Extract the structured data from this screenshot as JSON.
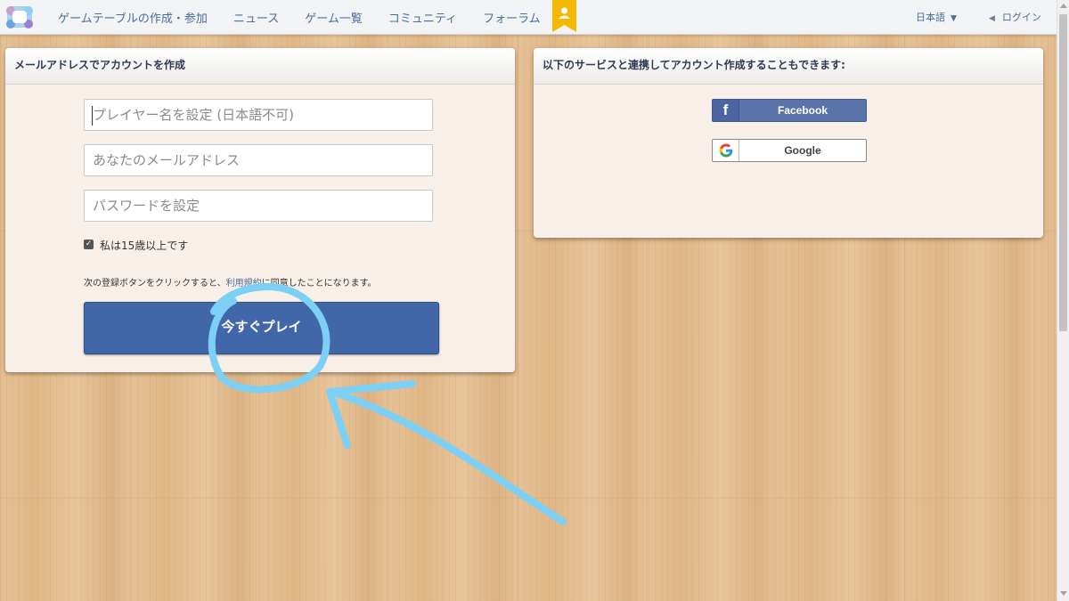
{
  "nav": {
    "items": [
      "ゲームテーブルの作成・参加",
      "ニュース",
      "ゲーム一覧",
      "コミュニティ",
      "フォーラム"
    ],
    "language": "日本語",
    "login": "ログイン"
  },
  "left_panel": {
    "title": "メールアドレスでアカウントを作成",
    "player_name_placeholder": "プレイヤー名を設定 (日本語不可)",
    "email_placeholder": "あなたのメールアドレス",
    "password_placeholder": "パスワードを設定",
    "age_check_label": "私は15歳以上です",
    "terms_prefix": "次の登録ボタンをクリックすると、",
    "terms_link": "利用規約",
    "terms_suffix": "に同意したことになります。",
    "play_button": "今すぐプレイ"
  },
  "right_panel": {
    "title": "以下のサービスと連携してアカウント作成することもできます:",
    "facebook_label": "Facebook",
    "google_label": "Google"
  },
  "colors": {
    "accent": "#4167a9",
    "nav_text": "#4b6e9c",
    "annotation": "#7ccff5",
    "badge": "#f5b800"
  },
  "icons": [
    "logo-icon",
    "ribbon-badge-icon",
    "caret-down-icon",
    "speaker-icon",
    "facebook-icon",
    "google-icon",
    "checkbox-checked-icon"
  ]
}
